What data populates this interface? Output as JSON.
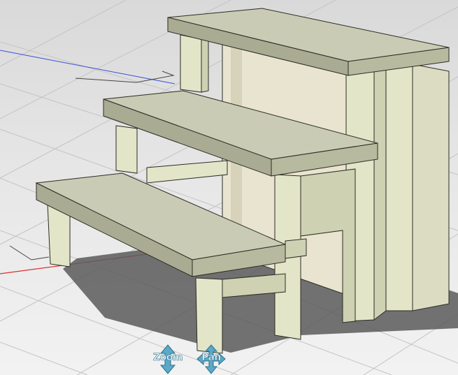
{
  "viewport": {
    "background_top": "#d9d9d9",
    "background_bottom": "#f2f2f2",
    "grid_color": "#c4c4c4",
    "x_axis_color": "#d83030",
    "y_axis_color": "#3b4fd8",
    "shadow_color": "#5a5a5a"
  },
  "model": {
    "wood_top": "#c9cbb4",
    "wood_front": "#a9ab93",
    "wood_leg": "#e3e5c8",
    "wood_leg_side": "#cfd1b3",
    "edge_color": "#2b2b24"
  },
  "navigation": {
    "zoom_label": "Zoom",
    "pan_label": "Pan",
    "arrow_color": "#5aa9c8"
  }
}
